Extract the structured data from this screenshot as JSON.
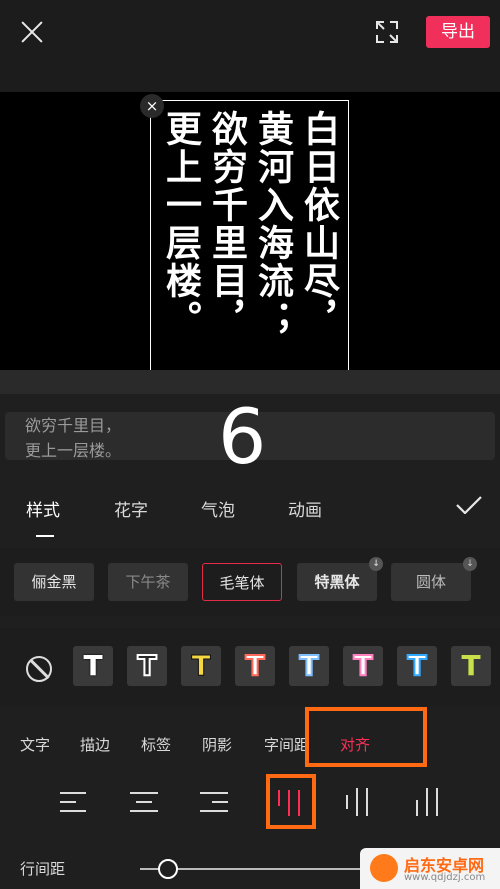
{
  "topbar": {
    "export_label": "导出"
  },
  "preview": {
    "columns": [
      "白日依山尽，",
      "黄河入海流；",
      "欲穷千里目，",
      "更上一层楼。"
    ],
    "box_close": "×"
  },
  "input": {
    "line1": "欲穷千里目，",
    "line2": "更上一层楼。"
  },
  "overlay_number": "6",
  "tabs": [
    {
      "label": "样式"
    },
    {
      "label": "花字"
    },
    {
      "label": "气泡"
    },
    {
      "label": "动画"
    }
  ],
  "fonts": [
    {
      "label": "俪金黑"
    },
    {
      "label": "下午茶"
    },
    {
      "label": "毛笔体"
    },
    {
      "label": "特黑体"
    },
    {
      "label": "圆体"
    }
  ],
  "swatch_letter": "T",
  "swatch_colors": [
    "#ffffff",
    "#ffffff",
    "#f5d742",
    "#ff7a6a",
    "#9ad0ff",
    "#ff7fbf",
    "#33aaff",
    "#c9e04a"
  ],
  "subtabs": [
    {
      "label": "文字"
    },
    {
      "label": "描边"
    },
    {
      "label": "标签"
    },
    {
      "label": "阴影"
    },
    {
      "label": "字间距"
    },
    {
      "label": "对齐"
    }
  ],
  "line_spacing_label": "行间距",
  "watermark": {
    "title": "启东安卓网",
    "url": "www.qdjdzj.com"
  },
  "colors": {
    "accent": "#f0305a",
    "highlight": "#ff6a13"
  }
}
